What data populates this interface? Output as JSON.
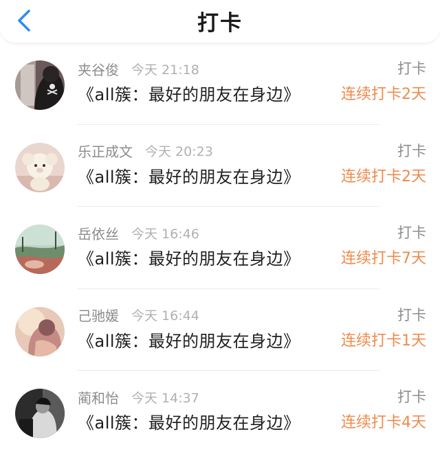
{
  "header": {
    "title": "打卡",
    "back_icon": "chevron-left-icon",
    "accent_color": "#2d8cf0"
  },
  "records": [
    {
      "name": "夹谷俊",
      "time": "今天 21:18",
      "action": "打卡",
      "book": "《all簇：最好的朋友在身边》",
      "streak": "连续打卡2天"
    },
    {
      "name": "乐正成文",
      "time": "今天 20:23",
      "action": "打卡",
      "book": "《all簇：最好的朋友在身边》",
      "streak": "连续打卡2天"
    },
    {
      "name": "岳依丝",
      "time": "今天 16:46",
      "action": "打卡",
      "book": "《all簇：最好的朋友在身边》",
      "streak": "连续打卡7天"
    },
    {
      "name": "己驰媛",
      "time": "今天 16:44",
      "action": "打卡",
      "book": "《all簇：最好的朋友在身边》",
      "streak": "连续打卡1天"
    },
    {
      "name": "蔺和怡",
      "time": "今天 14:37",
      "action": "打卡",
      "book": "《all簇：最好的朋友在身边》",
      "streak": "连续打卡4天"
    }
  ],
  "colors": {
    "streak": "#ef8a4b",
    "meta": "#8c8c8c"
  }
}
